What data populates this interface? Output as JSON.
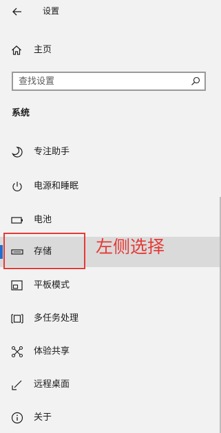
{
  "window": {
    "title": "设置"
  },
  "home": {
    "label": "主页"
  },
  "search": {
    "placeholder": "查找设置"
  },
  "section": {
    "heading": "系统"
  },
  "nav": {
    "items": [
      {
        "label": "专注助手",
        "icon": "moon-icon"
      },
      {
        "label": "电源和睡眠",
        "icon": "power-icon"
      },
      {
        "label": "电池",
        "icon": "battery-icon"
      },
      {
        "label": "存储",
        "icon": "storage-icon",
        "selected": true
      },
      {
        "label": "平板模式",
        "icon": "tablet-mode-icon"
      },
      {
        "label": "多任务处理",
        "icon": "multitasking-icon"
      },
      {
        "label": "体验共享",
        "icon": "shared-experiences-icon"
      },
      {
        "label": "远程桌面",
        "icon": "remote-desktop-icon"
      },
      {
        "label": "关于",
        "icon": "info-icon"
      }
    ]
  },
  "annotation": {
    "text": "左侧选择",
    "color": "#e53935"
  },
  "colors": {
    "background": "#f2f2f2",
    "selected": "#dadada",
    "accent": "#1f6fd0"
  }
}
